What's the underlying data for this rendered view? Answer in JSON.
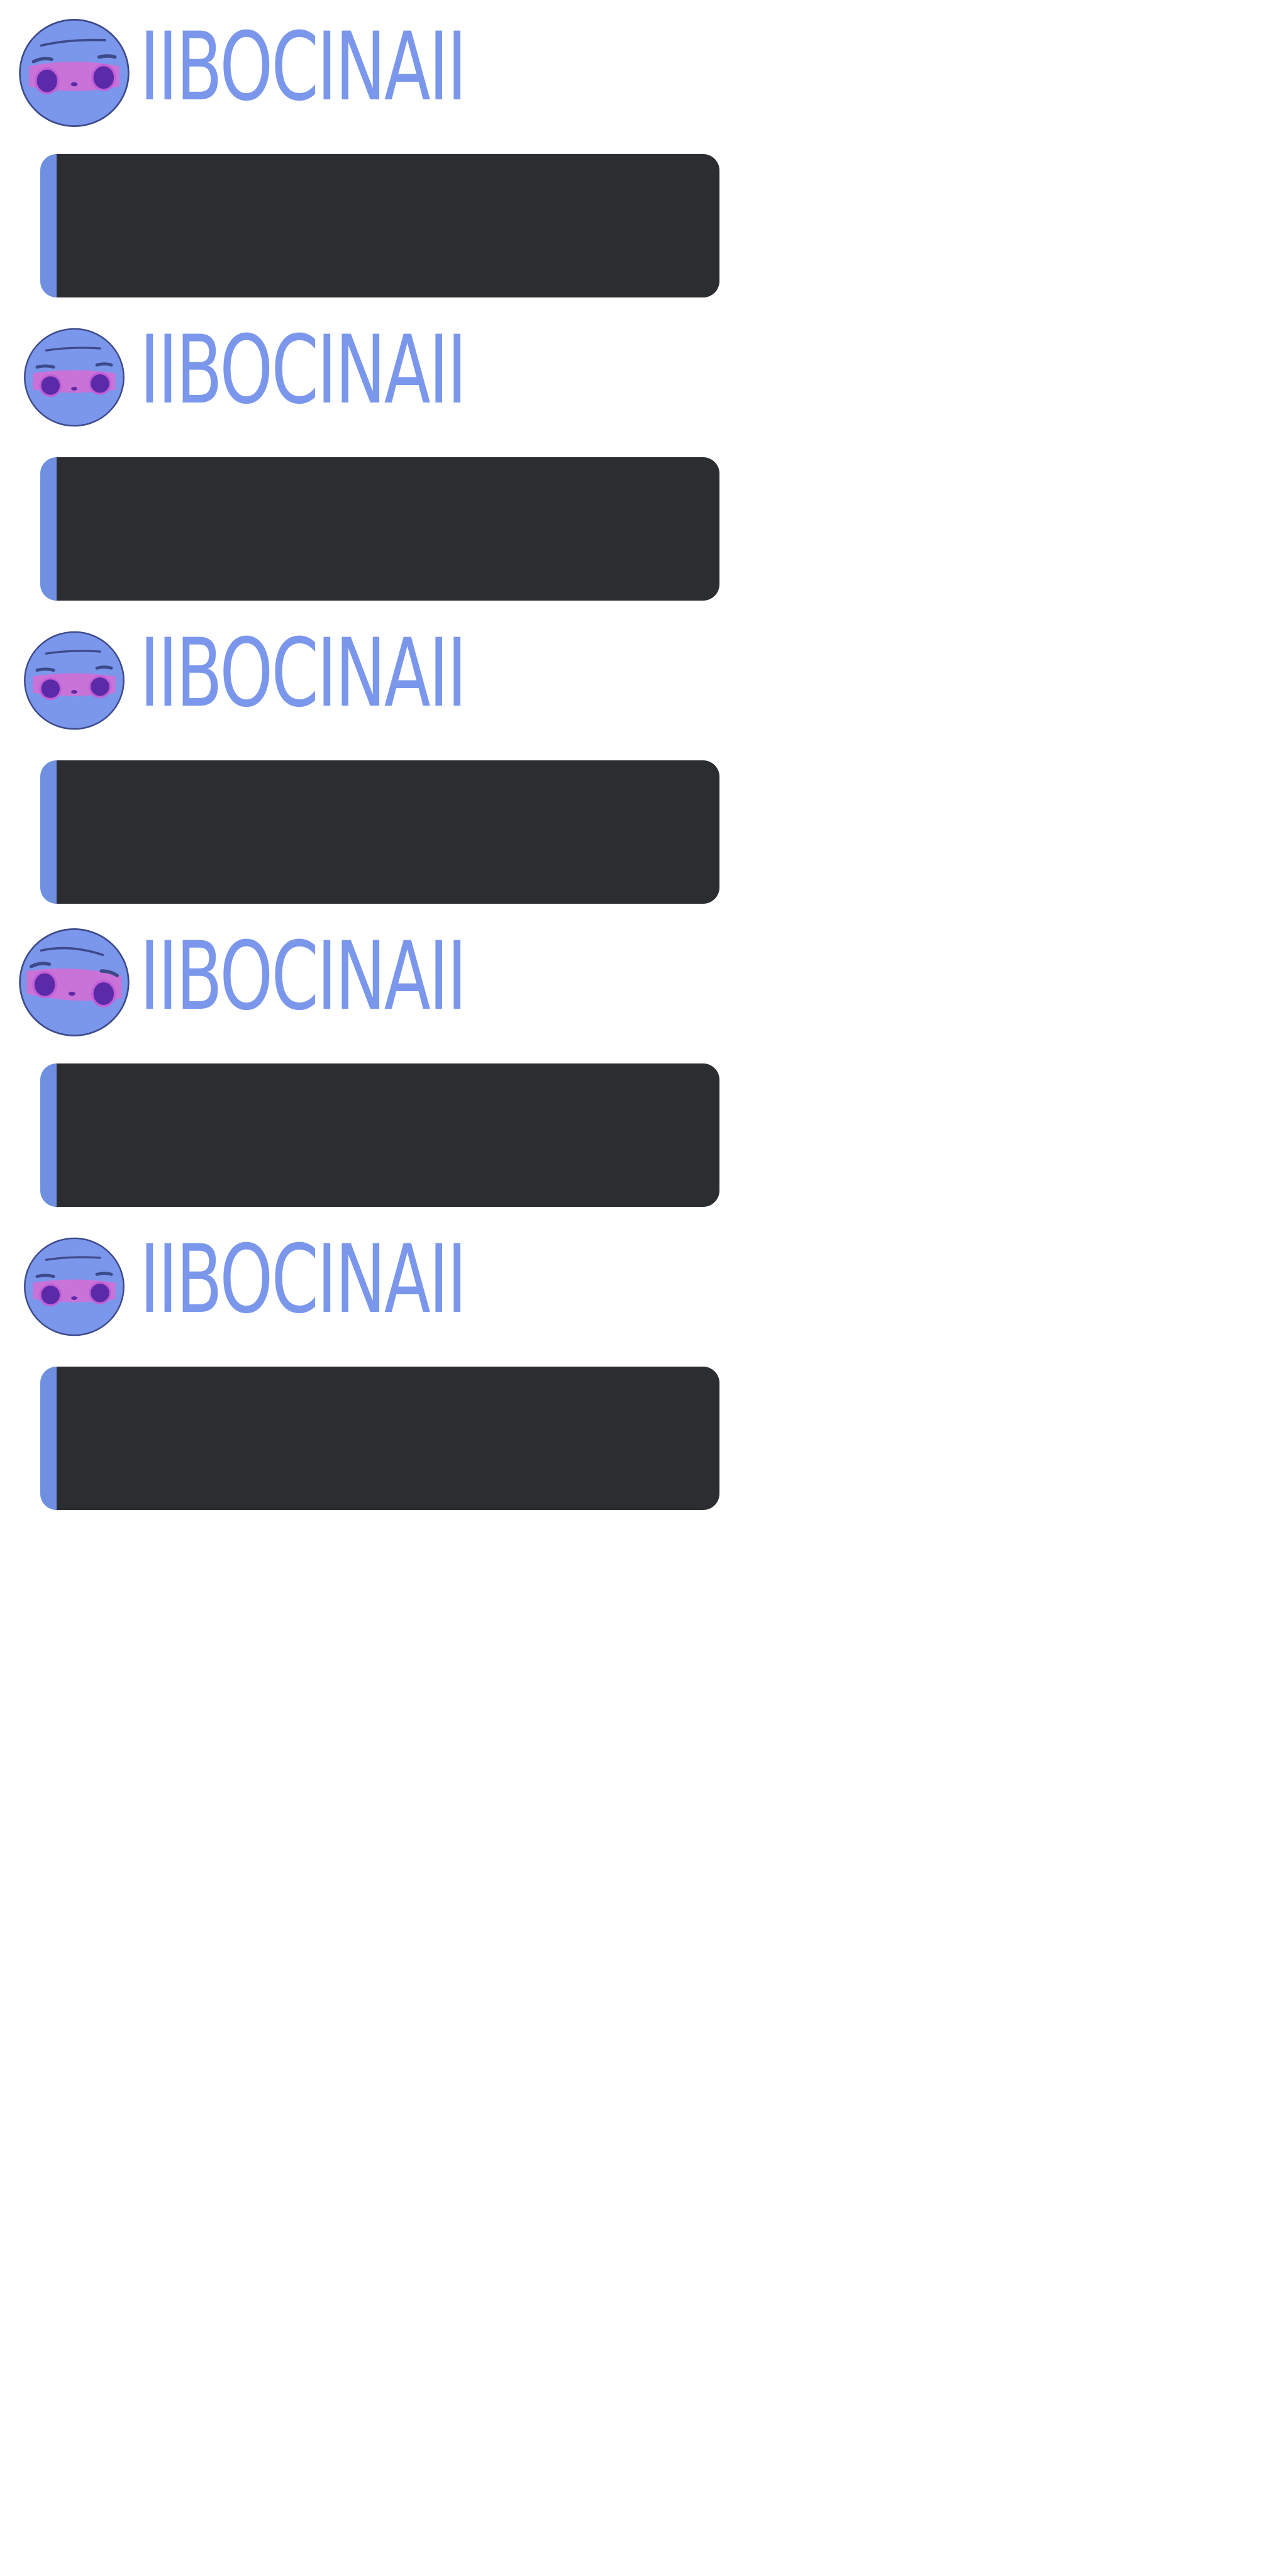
{
  "colors": {
    "name": "#7b97ec",
    "embed_background": "#2b2d31",
    "embed_accent": "#6f8fe0",
    "avatar_face": "#7b97ec",
    "avatar_blush": "#c973d9",
    "avatar_eyes": "#5b2aa8"
  },
  "messages": [
    {
      "author": "IIBOCINAII",
      "avatar_icon": "purple-face-avatar",
      "embed_text": ""
    },
    {
      "author": "IIBOCINAII",
      "avatar_icon": "purple-face-avatar",
      "embed_text": ""
    },
    {
      "author": "IIBOCINAII",
      "avatar_icon": "purple-face-avatar",
      "embed_text": ""
    },
    {
      "author": "IIBOCINAII",
      "avatar_icon": "purple-face-avatar",
      "embed_text": ""
    },
    {
      "author": "IIBOCINAII",
      "avatar_icon": "purple-face-avatar",
      "embed_text": ""
    }
  ]
}
